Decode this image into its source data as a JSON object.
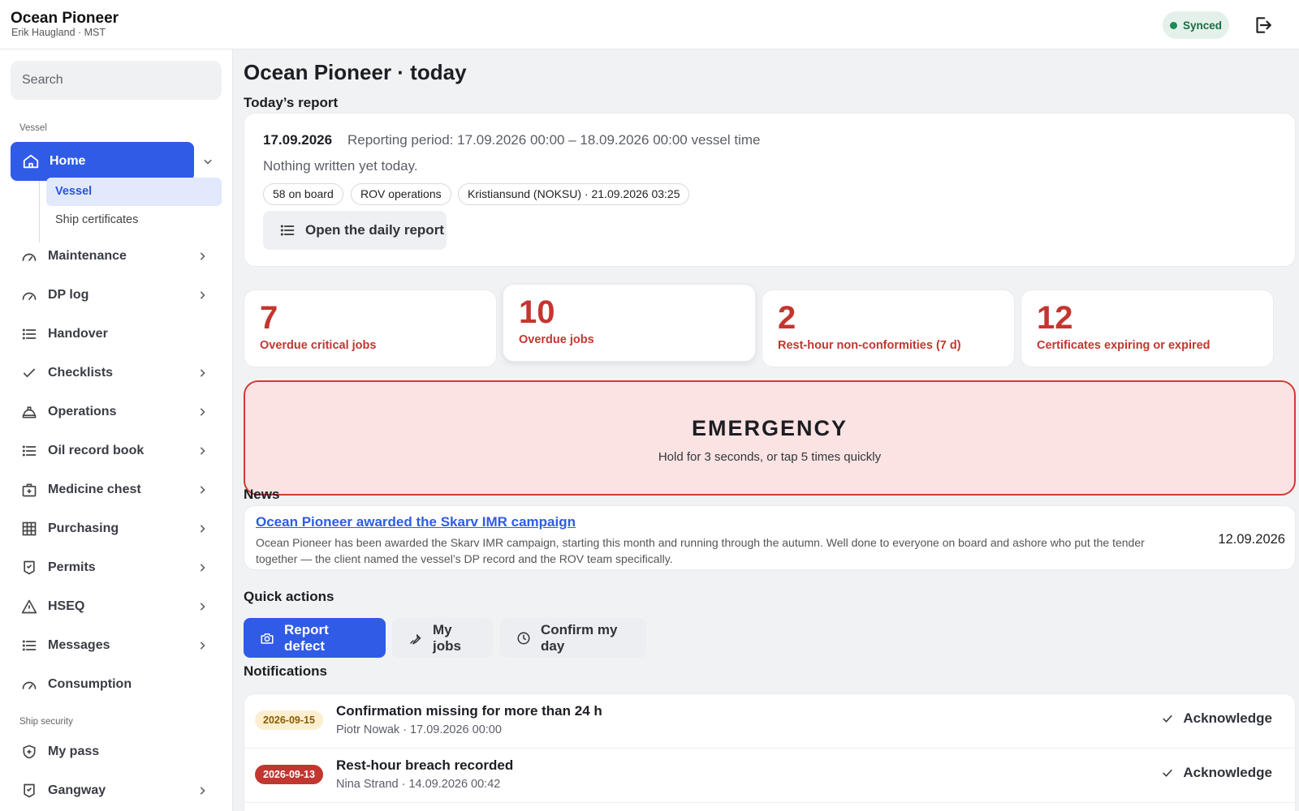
{
  "header": {
    "app_title": "Ocean Pioneer",
    "user_line": "Erik Haugland · MST",
    "sync_status": "Synced",
    "sync_color": "#1f8a55"
  },
  "sidebar": {
    "search_placeholder": "Search",
    "vessel_section": "Vessel",
    "home": {
      "label": "Home",
      "icon": "home-icon"
    },
    "home_sub": [
      {
        "label": "Vessel",
        "active": true
      },
      {
        "label": "Ship certificates",
        "active": false
      }
    ],
    "items": [
      {
        "label": "Maintenance",
        "icon": "gauge-icon",
        "chevron": true
      },
      {
        "label": "DP log",
        "icon": "gauge-icon",
        "chevron": true
      },
      {
        "label": "Handover",
        "icon": "list-icon",
        "chevron": false
      },
      {
        "label": "Checklists",
        "icon": "check-icon",
        "chevron": true
      },
      {
        "label": "Operations",
        "icon": "helmet-icon",
        "chevron": true
      },
      {
        "label": "Oil record book",
        "icon": "list-icon",
        "chevron": true
      },
      {
        "label": "Medicine chest",
        "icon": "medkit-icon",
        "chevron": true
      },
      {
        "label": "Purchasing",
        "icon": "grid-icon",
        "chevron": true
      },
      {
        "label": "Permits",
        "icon": "permit-icon",
        "chevron": true
      },
      {
        "label": "HSEQ",
        "icon": "warning-icon",
        "chevron": true
      },
      {
        "label": "Messages",
        "icon": "list-icon",
        "chevron": true
      },
      {
        "label": "Consumption",
        "icon": "gauge-icon",
        "chevron": false
      }
    ],
    "security_section": "Ship security",
    "security_items": [
      {
        "label": "My pass",
        "icon": "shield-plus-icon",
        "chevron": false
      },
      {
        "label": "Gangway",
        "icon": "permit-icon",
        "chevron": true
      }
    ],
    "accent": "#2f5be6"
  },
  "main": {
    "page_title": "Ocean Pioneer · today",
    "report_heading": "Today’s report",
    "report": {
      "date": "17.09.2026",
      "period": "Reporting period: 17.09.2026 00:00 – 18.09.2026 00:00 vessel time",
      "empty_text": "Nothing written yet today.",
      "chips": [
        "58 on board",
        "ROV operations",
        "Kristiansund (NOKSU) · 21.09.2026 03:25"
      ],
      "open_button": "Open the daily report"
    },
    "stats": [
      {
        "value": "7",
        "label": "Overdue critical jobs"
      },
      {
        "value": "10",
        "label": "Overdue jobs"
      },
      {
        "value": "2",
        "label": "Rest-hour non-conformities (7 d)"
      },
      {
        "value": "12",
        "label": "Certificates expiring or expired"
      }
    ],
    "stat_color": "#c3362f",
    "emergency": {
      "title": "EMERGENCY",
      "instruction": "Hold for 3 seconds, or tap 5 times quickly"
    },
    "news_heading": "News",
    "news": {
      "title": "Ocean Pioneer awarded the Skarv IMR campaign",
      "body": "Ocean Pioneer has been awarded the Skarv IMR campaign, starting this month and running through the autumn. Well done to everyone on board and ashore who put the tender together — the client named the vessel’s DP record and the ROV team specifically.",
      "date": "12.09.2026"
    },
    "quick_actions_heading": "Quick actions",
    "quick_actions": [
      {
        "label": "Report defect",
        "icon": "camera-icon",
        "primary": true
      },
      {
        "label": "My jobs",
        "icon": "wrench-icon",
        "primary": false
      },
      {
        "label": "Confirm my day",
        "icon": "clock-icon",
        "primary": false
      }
    ],
    "notifications_heading": "Notifications",
    "notifications": [
      {
        "badge": "2026-09-15",
        "severity": "warning",
        "title": "Confirmation missing for more than 24 h",
        "meta": "Piotr Nowak · 17.09.2026 00:00",
        "action": "Acknowledge"
      },
      {
        "badge": "2026-09-13",
        "severity": "critical",
        "title": "Rest-hour breach recorded",
        "meta": "Nina Strand · 14.09.2026 00:42",
        "action": "Acknowledge"
      }
    ]
  }
}
